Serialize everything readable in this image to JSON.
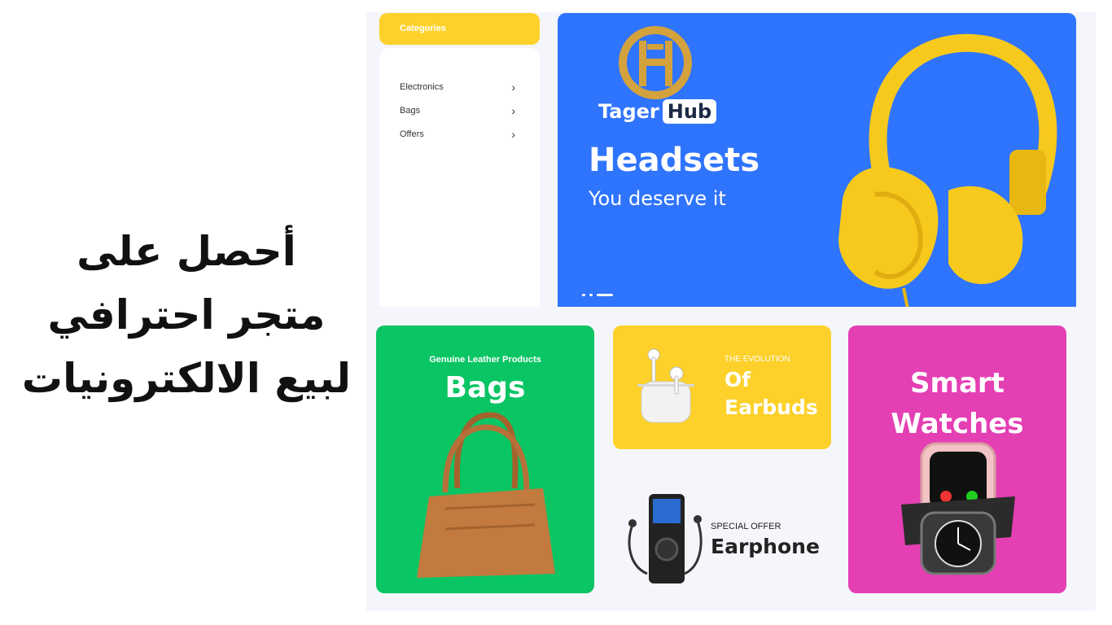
{
  "headline": {
    "line1": "أحصل على",
    "line2": "متجر  احترافي",
    "line3": "لبيع الالكترونيات"
  },
  "categories": {
    "title": "Categories",
    "items": [
      {
        "label": "Electronics"
      },
      {
        "label": "Bags"
      },
      {
        "label": "Offers"
      }
    ]
  },
  "hero": {
    "brand_name": "Tager",
    "brand_badge": "Hub",
    "title": "Headsets",
    "subtitle": "You deserve it",
    "slide_count": 3,
    "active_slide": 3
  },
  "cards": {
    "bags": {
      "subtitle": "Genuine Leather Products",
      "title": "Bags"
    },
    "earbuds": {
      "subtitle": "THE EVOLUTION",
      "title_line1": "Of",
      "title_line2": "Earbuds"
    },
    "earphone": {
      "subtitle": "SPECIAL OFFER",
      "title": "Earphone"
    },
    "watches": {
      "title_line1": "Smart",
      "title_line2": "Watches"
    }
  },
  "colors": {
    "accent_yellow": "#fdd12a",
    "hero_blue": "#2f74fd",
    "bags_green": "#0ac563",
    "watches_pink": "#e53fb4",
    "logo_gold": "#d4a23c"
  },
  "icons": {
    "category_chevron": "chevron-right-icon"
  }
}
